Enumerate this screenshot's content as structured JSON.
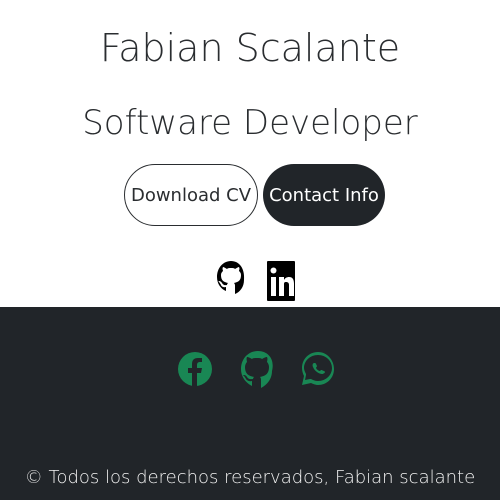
{
  "header": {
    "name": "Fabian Scalante",
    "role": "Software Developer"
  },
  "actions": {
    "download_cv": "Download CV",
    "contact_info": "Contact Info"
  },
  "social_top": [
    {
      "icon": "github-icon"
    },
    {
      "icon": "linkedin-icon"
    }
  ],
  "footer": {
    "icons": [
      {
        "icon": "facebook-icon"
      },
      {
        "icon": "github-icon"
      },
      {
        "icon": "whatsapp-icon"
      }
    ],
    "copyright": "© Todos los derechos reservados, Fabian scalante"
  },
  "colors": {
    "text": "#2a2d30",
    "dark": "#212529",
    "accent_green": "#198754",
    "white": "#ffffff"
  }
}
